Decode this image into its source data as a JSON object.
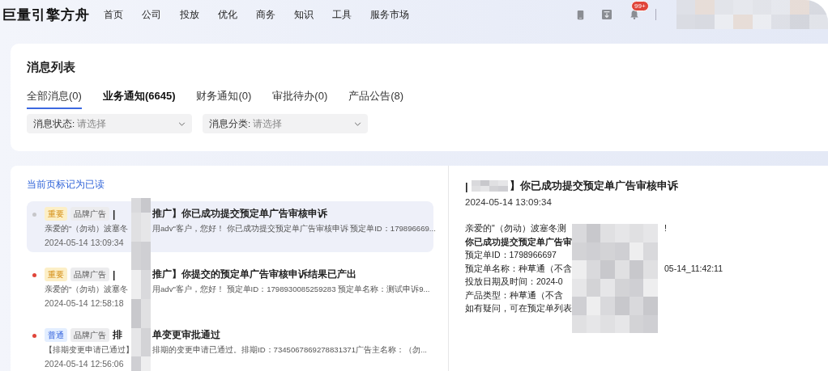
{
  "brand": "巨量引擎方舟",
  "nav": [
    {
      "label": "首页"
    },
    {
      "label": "公司"
    },
    {
      "label": "投放"
    },
    {
      "label": "优化"
    },
    {
      "label": "商务"
    },
    {
      "label": "知识"
    },
    {
      "label": "工具"
    },
    {
      "label": "服务市场"
    }
  ],
  "notification_badge": "99+",
  "page_title": "消息列表",
  "tabs": [
    {
      "label": "全部消息(0)",
      "selected": true
    },
    {
      "label": "业务通知(6645)",
      "selected": false
    },
    {
      "label": "财务通知(0)",
      "selected": false
    },
    {
      "label": "审批待办(0)",
      "selected": false
    },
    {
      "label": "产品公告(8)",
      "selected": false
    }
  ],
  "filters": [
    {
      "label": "消息状态:",
      "placeholder": "请选择"
    },
    {
      "label": "消息分类:",
      "placeholder": "请选择"
    }
  ],
  "mark_read_link": "当前页标记为已读",
  "messages": [
    {
      "read": true,
      "selected": true,
      "priority": {
        "kind": "important",
        "label": "重要"
      },
      "category": "品牌广告",
      "title_start": "|",
      "title_end": "推广】你已成功提交预定单广告审核申诉",
      "body_start": "亲爱的\"（勿动）波塞冬",
      "body_end": "用adv\"客户，您好！ 你已成功提交预定单广告审核申诉 预定单ID：179896669...",
      "time": "2024-05-14 13:09:34"
    },
    {
      "read": false,
      "selected": false,
      "priority": {
        "kind": "important",
        "label": "重要"
      },
      "category": "品牌广告",
      "title_start": "|",
      "title_end": "推广】你提交的预定单广告审核申诉结果已产出",
      "body_start": "亲爱的\"（勿动）波塞冬",
      "body_end": "用adv\"客户，您好！ 预定单ID：1798930085259283 预定单名称：测试申诉9...",
      "time": "2024-05-14 12:58:18"
    },
    {
      "read": false,
      "selected": false,
      "priority": {
        "kind": "normal",
        "label": "普通"
      },
      "category": "品牌广告",
      "title_start": "排",
      "title_end": "单变更审批通过",
      "body_start": "【排期变更申请已通过】",
      "body_end": "排期的变更申请已通过。排期ID：7345067869278831371广告主名称：（勿...",
      "time": "2024-05-14 12:56:06"
    }
  ],
  "detail": {
    "title_start": "|",
    "title_end": "】你已成功提交预定单广告审核申诉",
    "time": "2024-05-14 13:09:34",
    "lines": [
      {
        "start": "亲爱的\"（勿动）波塞冬测",
        "end": "!",
        "bold": false
      },
      {
        "start": "你已成功提交预定单广告审",
        "bold": true
      },
      {
        "start": "预定单ID：1798966697",
        "bold": false
      },
      {
        "start": "预定单名称：种草通（不含",
        "end": "05-14_11:42:11",
        "bold": false
      },
      {
        "start": "投放日期及时间：2024-0",
        "bold": false
      },
      {
        "start": "产品类型：种草通（不含",
        "bold": false
      },
      {
        "start": "如有疑问，可在预定单列表",
        "bold": false
      }
    ]
  }
}
